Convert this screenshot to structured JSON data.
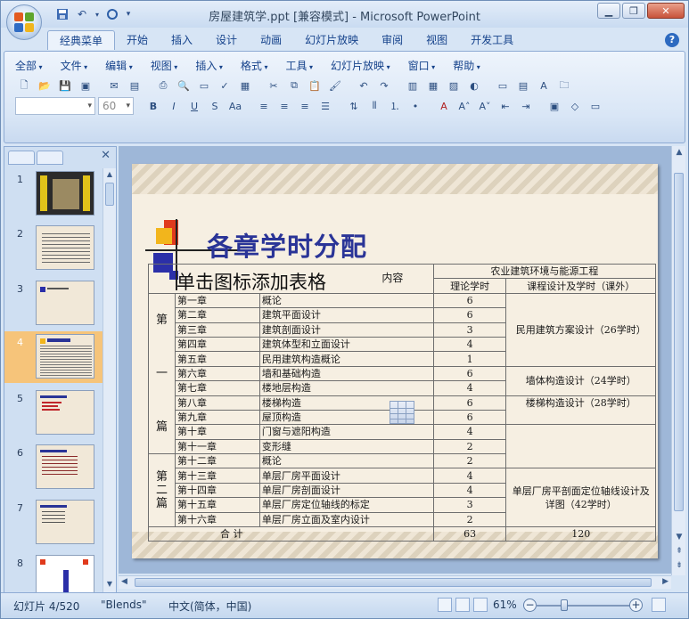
{
  "window": {
    "title": "房屋建筑学.ppt [兼容模式] - Microsoft PowerPoint"
  },
  "ribbon": {
    "tabs": [
      "经典菜单",
      "开始",
      "插入",
      "设计",
      "动画",
      "幻灯片放映",
      "审阅",
      "视图",
      "开发工具"
    ],
    "active_tab": "经典菜单",
    "menus": [
      "全部",
      "文件",
      "编辑",
      "视图",
      "插入",
      "格式",
      "工具",
      "幻灯片放映",
      "窗口",
      "帮助"
    ],
    "font_size_value": "60"
  },
  "thumbnails": {
    "numbers": [
      "1",
      "2",
      "3",
      "4",
      "5",
      "6",
      "7",
      "8"
    ],
    "selected": "4"
  },
  "slide": {
    "title": "各章学时分配",
    "placeholder": "单击图标添加表格",
    "header_overlay": "内容"
  },
  "table": {
    "header_top": "农业建筑环境与能源工程",
    "header_hours": "理论学时",
    "header_design": "课程设计及学时（课外）",
    "part1_chars": [
      "第",
      "一",
      "篇"
    ],
    "part2_chars": [
      "第",
      "二",
      "篇"
    ],
    "rows": [
      {
        "chapter": "第一章",
        "content": "概论",
        "hours": "6"
      },
      {
        "chapter": "第二章",
        "content": "建筑平面设计",
        "hours": "6"
      },
      {
        "chapter": "第三章",
        "content": "建筑剖面设计",
        "hours": "3"
      },
      {
        "chapter": "第四章",
        "content": "建筑体型和立面设计",
        "hours": "4"
      },
      {
        "chapter": "第五章",
        "content": "民用建筑构造概论",
        "hours": "1"
      },
      {
        "chapter": "第六章",
        "content": "墙和基础构造",
        "hours": "6"
      },
      {
        "chapter": "第七章",
        "content": "楼地层构造",
        "hours": "4"
      },
      {
        "chapter": "第八章",
        "content": "楼梯构造",
        "hours": "6"
      },
      {
        "chapter": "第九章",
        "content": "屋顶构造",
        "hours": "6"
      },
      {
        "chapter": "第十章",
        "content": "门窗与遮阳构造",
        "hours": "4"
      },
      {
        "chapter": "第十一章",
        "content": "变形缝",
        "hours": "2"
      },
      {
        "chapter": "第十二章",
        "content": "概论",
        "hours": "2"
      },
      {
        "chapter": "第十三章",
        "content": "单层厂房平面设计",
        "hours": "4"
      },
      {
        "chapter": "第十四章",
        "content": "单层厂房剖面设计",
        "hours": "4"
      },
      {
        "chapter": "第十五章",
        "content": "单层厂房定位轴线的标定",
        "hours": "3"
      },
      {
        "chapter": "第十六章",
        "content": "单层厂房立面及室内设计",
        "hours": "2"
      }
    ],
    "design_groups": {
      "g1": "民用建筑方案设计（26学时）",
      "g2": "墙体构造设计（24学时）",
      "g3": "楼梯构造设计（28学时）",
      "g4": "单层厂房平剖面定位轴线设计及详图（42学时）"
    },
    "total_label": "合   计",
    "total_hours": "63",
    "total_design": "120"
  },
  "statusbar": {
    "slide_info": "幻灯片 4/520",
    "theme": "\"Blends\"",
    "language": "中文(简体，中国)",
    "zoom": "61%"
  }
}
